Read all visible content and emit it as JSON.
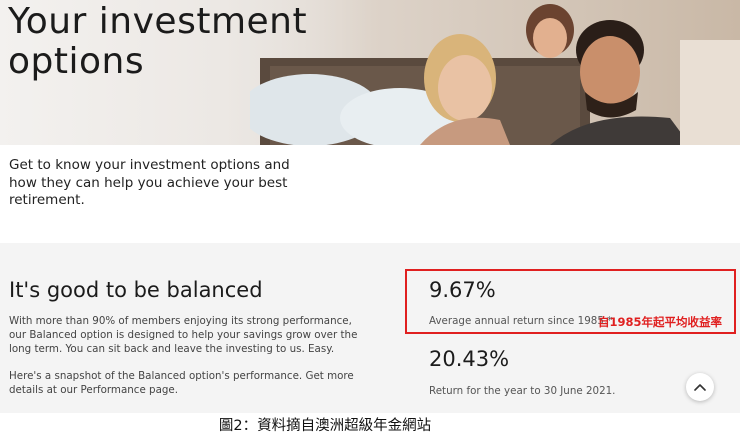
{
  "hero": {
    "title": "Your investment options"
  },
  "intro": {
    "text": "Get to know your investment options and how they can help you achieve your best retirement."
  },
  "balanced": {
    "title": "It's good to be balanced",
    "paragraph1": "With more than 90% of members enjoying its strong performance, our Balanced option is designed to help your savings grow over the long term. You can sit back and leave the investing to us. Easy.",
    "paragraph2": "Here's a snapshot of the Balanced option's performance. Get more details at our Performance page."
  },
  "stats": [
    {
      "value": "9.67%",
      "label": "Average annual return since 1985.*"
    },
    {
      "value": "20.43%",
      "label": "Return for the year to 30 June 2021."
    }
  ],
  "annotation": {
    "note": "自1985年起平均收益率",
    "color": "#e02020"
  },
  "caption": "圖2：資料摘自澳洲超級年金網站",
  "icons": {
    "scroll_top": "chevron-up-icon"
  }
}
